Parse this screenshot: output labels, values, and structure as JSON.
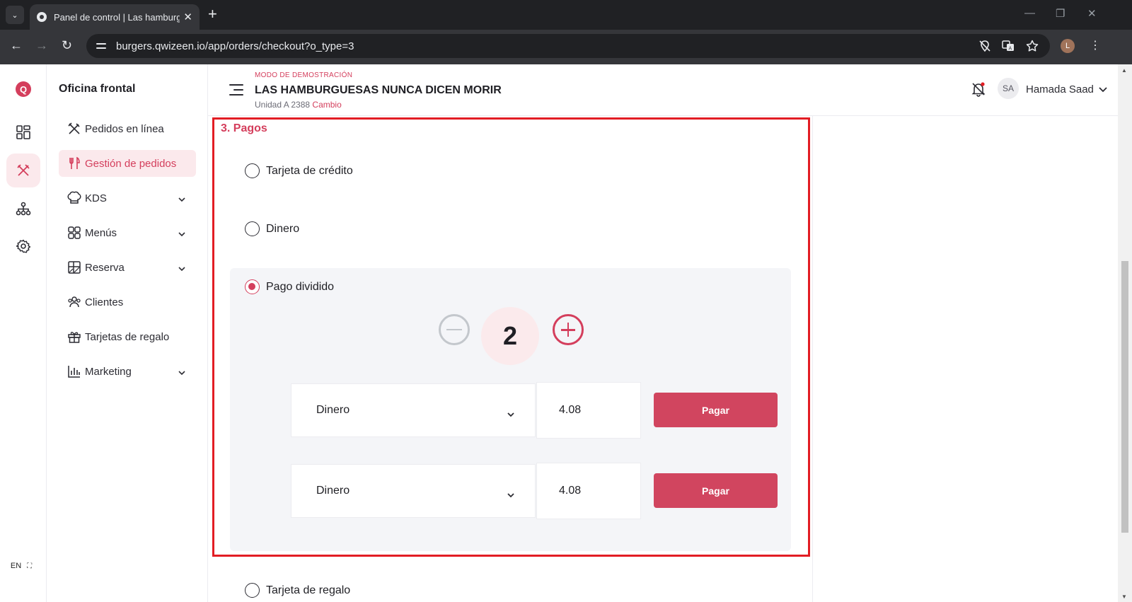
{
  "browser": {
    "tab_title": "Panel de control | Las hamburguesas nunca dicen morir",
    "url": "burgers.qwizeen.io/app/orders/checkout?o_type=3",
    "profile_initial": "L"
  },
  "rail": {
    "logo_letter": "Q",
    "language": "EN"
  },
  "sidebar": {
    "title": "Oficina frontal",
    "items": [
      {
        "label": "Pedidos en línea",
        "icon": "fork-knife-icon"
      },
      {
        "label": "Gestión de pedidos",
        "icon": "utensils-icon",
        "active": true
      },
      {
        "label": "KDS",
        "icon": "chef-hat-icon",
        "has_children": true
      },
      {
        "label": "Menús",
        "icon": "grid-icon",
        "has_children": true
      },
      {
        "label": "Reserva",
        "icon": "table-icon",
        "has_children": true
      },
      {
        "label": "Clientes",
        "icon": "users-icon"
      },
      {
        "label": "Tarjetas de regalo",
        "icon": "gift-icon"
      },
      {
        "label": "Marketing",
        "icon": "bar-chart-icon",
        "has_children": true
      }
    ]
  },
  "header": {
    "demo_label": "MODO DE DEMOSTRACIÓN",
    "restaurant_name": "LAS HAMBURGUESAS NUNCA DICEN MORIR",
    "unit_label": "Unidad A 2388",
    "change_link": "Cambio",
    "avatar_initials": "SA",
    "user_name": "Hamada Saad"
  },
  "payments": {
    "section_title": "3. Pagos",
    "options": [
      {
        "label": "Tarjeta de crédito",
        "checked": false
      },
      {
        "label": "Dinero",
        "checked": false
      },
      {
        "label": "Pago dividido",
        "checked": true
      },
      {
        "label": "Tarjeta de regalo",
        "checked": false
      }
    ],
    "split_count": "2",
    "split_rows": [
      {
        "method": "Dinero",
        "amount": "4.08",
        "button": "Pagar"
      },
      {
        "method": "Dinero",
        "amount": "4.08",
        "button": "Pagar"
      }
    ]
  },
  "colors": {
    "accent": "#d43e5c",
    "accent_light": "#fbe9ec",
    "highlight_border": "#e21d24"
  }
}
